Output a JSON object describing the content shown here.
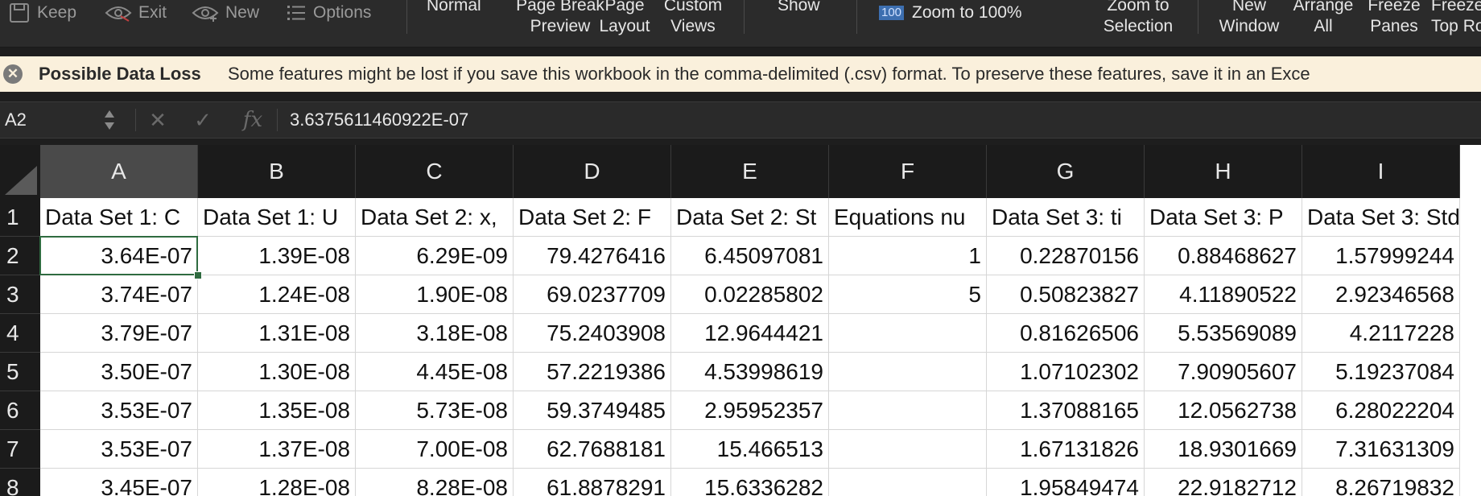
{
  "ribbon": {
    "keep_label": "Keep",
    "exit_label": "Exit",
    "new_label": "New",
    "options_label": "Options",
    "normal_label": "Normal",
    "page_break_label": "Page Break\nPreview",
    "page_layout_label": "Page\nLayout",
    "custom_views_label": "Custom\nViews",
    "show_label": "Show",
    "zoom_icon_text": "100",
    "zoom100_label": "Zoom to 100%",
    "zoom_selection_label": "Zoom to\nSelection",
    "new_window_label": "New\nWindow",
    "arrange_all_label": "Arrange\nAll",
    "freeze_panes_label": "Freeze\nPanes",
    "freeze_top_label": "Freeze\nTop Ro"
  },
  "message_bar": {
    "title": "Possible Data Loss",
    "text": "Some features might be lost if you save this workbook in the comma-delimited (.csv) format. To preserve these features, save it in an Exce"
  },
  "formula_bar": {
    "name_box": "A2",
    "value": "3.6375611460922E-07"
  },
  "sheet": {
    "columns": [
      "A",
      "B",
      "C",
      "D",
      "E",
      "F",
      "G",
      "H",
      "I"
    ],
    "selected_column": "A",
    "rows": [
      {
        "num": "1",
        "cells": [
          "Data Set 1: C",
          "Data Set 1: U",
          "Data Set 2: x,",
          "Data Set 2: F",
          "Data Set 2: St",
          "Equations nu",
          "Data Set 3: ti",
          "Data Set 3: P",
          "Data Set 3: Std"
        ]
      },
      {
        "num": "2",
        "cells": [
          "3.64E-07",
          "1.39E-08",
          "6.29E-09",
          "79.4276416",
          "6.45097081",
          "1",
          "0.22870156",
          "0.88468627",
          "1.57999244"
        ]
      },
      {
        "num": "3",
        "cells": [
          "3.74E-07",
          "1.24E-08",
          "1.90E-08",
          "69.0237709",
          "0.02285802",
          "5",
          "0.50823827",
          "4.11890522",
          "2.92346568"
        ]
      },
      {
        "num": "4",
        "cells": [
          "3.79E-07",
          "1.31E-08",
          "3.18E-08",
          "75.2403908",
          "12.9644421",
          "",
          "0.81626506",
          "5.53569089",
          "4.2117228"
        ]
      },
      {
        "num": "5",
        "cells": [
          "3.50E-07",
          "1.30E-08",
          "4.45E-08",
          "57.2219386",
          "4.53998619",
          "",
          "1.07102302",
          "7.90905607",
          "5.19237084"
        ]
      },
      {
        "num": "6",
        "cells": [
          "3.53E-07",
          "1.35E-08",
          "5.73E-08",
          "59.3749485",
          "2.95952357",
          "",
          "1.37088165",
          "12.0562738",
          "6.28022204"
        ]
      },
      {
        "num": "7",
        "cells": [
          "3.53E-07",
          "1.37E-08",
          "7.00E-08",
          "62.7688181",
          "15.466513",
          "",
          "1.67131826",
          "18.9301669",
          "7.31631309"
        ]
      },
      {
        "num": "8",
        "cells": [
          "3.45E-07",
          "1.28E-08",
          "8.28E-08",
          "61.8878291",
          "15.6336282",
          "",
          "1.95849474",
          "22.9182712",
          "8.26719832"
        ]
      }
    ]
  }
}
